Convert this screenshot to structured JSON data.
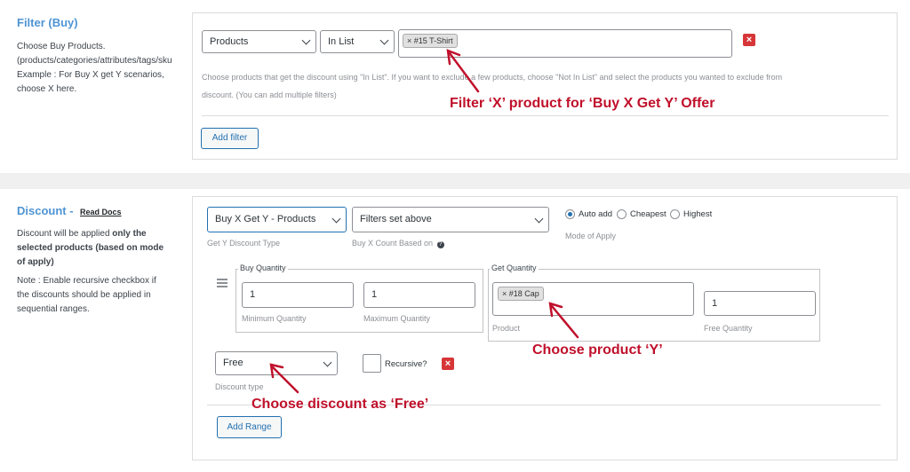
{
  "filter": {
    "title": "Filter (Buy)",
    "desc_lines": [
      "Choose Buy Products.",
      "(products/categories/attributes/tags/sku",
      "Example : For Buy X get Y scenarios,",
      "choose X here."
    ],
    "type_select": "Products",
    "method_select": "In List",
    "selected_tag": "× #15 T-Shirt",
    "help_line1": "Choose products that get the discount using \"In List\". If you want to exclude a few products, choose \"Not In List\" and select the products you wanted to exclude from",
    "help_line2": "discount. (You can add multiple filters)",
    "add_filter": "Add filter",
    "annotation": "Filter ‘X’ product for ‘Buy X Get Y’ Offer"
  },
  "discount": {
    "title": "Discount -",
    "read_docs": "Read Docs",
    "desc1_a": "Discount will be applied ",
    "desc1_b": "only the",
    "desc2": "selected products (based on mode",
    "desc3": "of apply)",
    "note_lines": [
      "Note : Enable recursive checkbox if",
      "the discounts should be applied in",
      "sequential ranges."
    ],
    "type_select": "Buy X Get Y - Products",
    "type_label": "Get Y Discount Type",
    "count_select": "Filters set above",
    "count_label": "Buy X Count Based on",
    "modes": [
      "Auto add",
      "Cheapest",
      "Highest"
    ],
    "mode_selected": "Auto add",
    "mode_label": "Mode of Apply",
    "buy_qty": {
      "legend": "Buy Quantity",
      "min_value": "1",
      "min_label": "Minimum Quantity",
      "max_value": "1",
      "max_label": "Maximum Quantity"
    },
    "get_qty": {
      "legend": "Get Quantity",
      "product_tag": "× #18 Cap",
      "product_label": "Product",
      "free_value": "1",
      "free_label": "Free Quantity"
    },
    "discount_type_select": "Free",
    "discount_type_label": "Discount type",
    "recursive_label": "Recursive?",
    "add_range": "Add Range",
    "annotation_product": "Choose product ‘Y’",
    "annotation_discount": "Choose discount as ‘Free’"
  },
  "colors": {
    "annotation": "#c0102b",
    "accent": "#2271b1",
    "danger": "#d63638",
    "title": "#4f94d4"
  }
}
